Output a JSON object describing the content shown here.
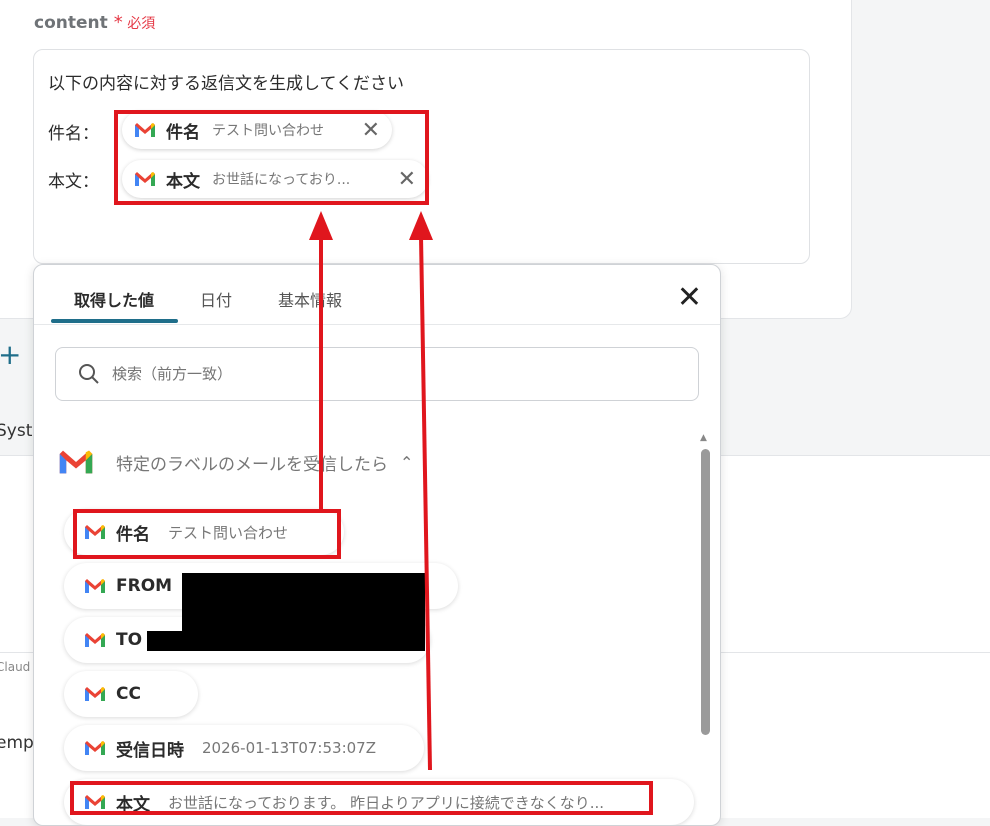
{
  "field": {
    "name": "content",
    "required_star": "*",
    "required_label": "必須"
  },
  "textarea": {
    "line1": "以下の内容に対する返信文を生成してください",
    "row1_label": "件名：",
    "row2_label": "本文：",
    "chip1": {
      "label": "件名",
      "value": "テスト問い合わせ",
      "icon": "gmail-icon"
    },
    "chip2": {
      "label": "本文",
      "value": "お世話になっており...",
      "icon": "gmail-icon"
    }
  },
  "background": {
    "plus": "+",
    "syst": "Syst",
    "claud": "Claud",
    "temp": "emp"
  },
  "popup": {
    "tabs": [
      {
        "label": "取得した値"
      },
      {
        "label": "日付"
      },
      {
        "label": "基本情報"
      }
    ],
    "close": "✕",
    "search_placeholder": "検索（前方一致）",
    "group_title": "特定のラベルのメールを受信したら",
    "group_chevron": "^",
    "items": [
      {
        "label": "件名",
        "value": "テスト問い合わせ"
      },
      {
        "label": "FROM",
        "value": ""
      },
      {
        "label": "TO",
        "value": ""
      },
      {
        "label": "CC",
        "value": ""
      },
      {
        "label": "受信日時",
        "value": "2026-01-13T07:53:07Z"
      },
      {
        "label": "本文",
        "value": "お世話になっております。 昨日よりアプリに接続できなくなり..."
      }
    ]
  },
  "colors": {
    "accent": "#1f6e8a",
    "highlight": "#e0161d",
    "required": "#e53946"
  }
}
